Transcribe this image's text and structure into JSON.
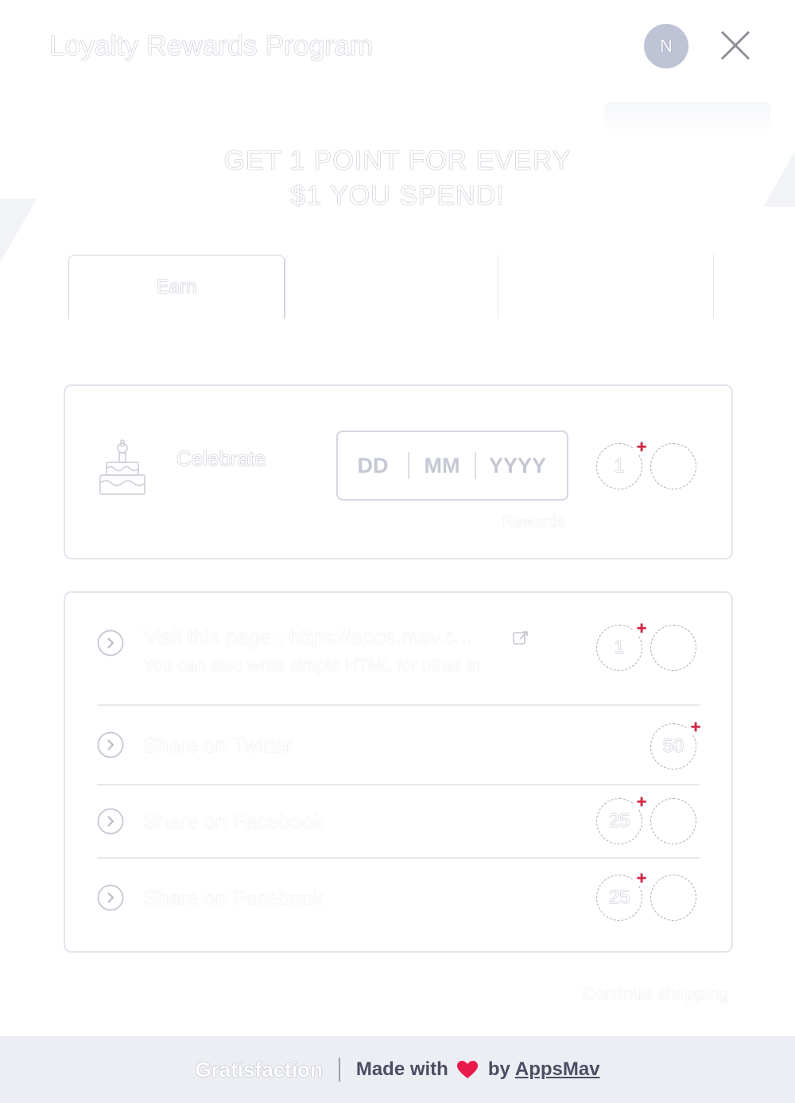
{
  "header": {
    "title": "Loyalty Rewards Program",
    "avatar_initial": "N"
  },
  "hero": {
    "line1": "GET 1 POINT FOR EVERY",
    "line2": "$1 YOU SPEND!"
  },
  "tabs": [
    {
      "label": "Earn",
      "active": true
    },
    {
      "label": "",
      "active": false
    },
    {
      "label": "",
      "active": false
    }
  ],
  "birthday": {
    "label": "Celebrate",
    "day_placeholder": "DD",
    "month_placeholder": "MM",
    "year_placeholder": "YYYY",
    "rewards_label": "Rewards",
    "points": "1"
  },
  "tasks": [
    {
      "title": "Visit this page : https://apps.mav.c...",
      "subtitle": "You can also write simple HTML for other in",
      "points": "1"
    },
    {
      "title": "Share on Twitter",
      "points": "50"
    },
    {
      "title": "Share on Facebook",
      "points": "25"
    },
    {
      "title": "Share on Facebook",
      "points": "25"
    }
  ],
  "continue_label": "Continue shopping",
  "footer": {
    "brand": "Gratisfaction",
    "made_with": "Made with",
    "by": "by",
    "company": "AppsMav",
    "heart_color": "#e8194b"
  },
  "colors": {
    "plus_badge": "#e02040",
    "avatar_bg": "#bfc3d6",
    "footer_bg": "#eceef3"
  }
}
